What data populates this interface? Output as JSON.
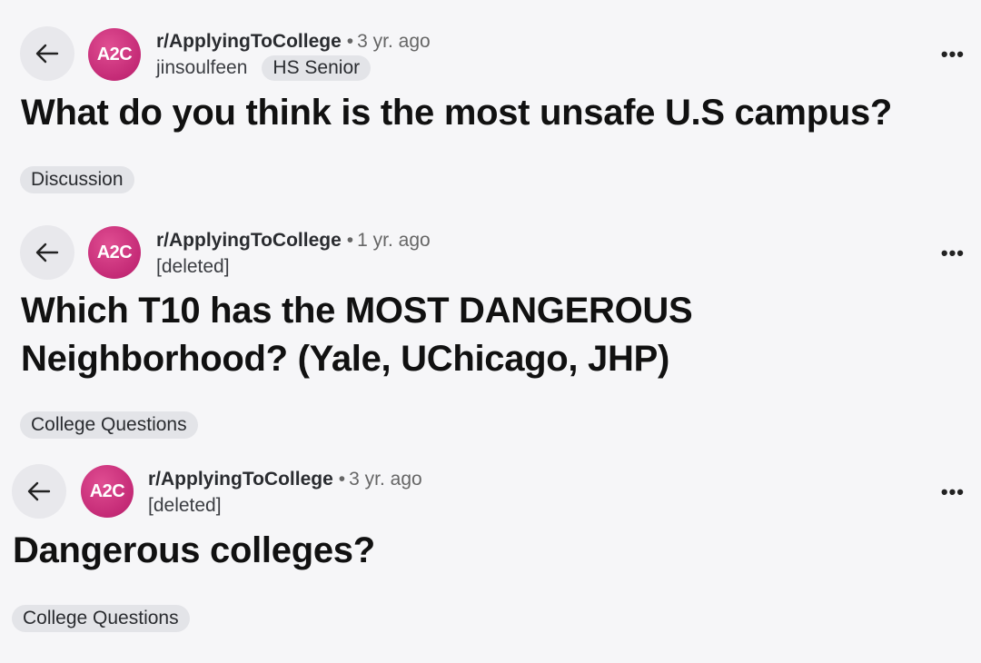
{
  "posts": [
    {
      "subreddit": "r/ApplyingToCollege",
      "age": "3 yr. ago",
      "author": "jinsoulfeen",
      "author_flair": "HS Senior",
      "title": "What do you think is the most unsafe U.S campus?",
      "tag": "Discussion",
      "more": "•••"
    },
    {
      "subreddit": "r/ApplyingToCollege",
      "age": "1 yr. ago",
      "author": "[deleted]",
      "title_line1": "Which T10 has the MOST DANGEROUS",
      "title_line2": "Neighborhood? (Yale, UChicago, JHP)",
      "tag": "College Questions",
      "more": "•••"
    },
    {
      "subreddit": "r/ApplyingToCollege",
      "age": "3 yr. ago",
      "author": "[deleted]",
      "title": "Dangerous colleges?",
      "tag": "College Questions",
      "more": "•••"
    }
  ],
  "avatar_text": "A2C",
  "separator": "•",
  "icons": {
    "back": "arrow-left-icon",
    "more": "more-horizontal-icon"
  },
  "colors": {
    "avatar": "#c42a76",
    "background": "#f6f6f8",
    "chip": "#e3e4e8"
  }
}
